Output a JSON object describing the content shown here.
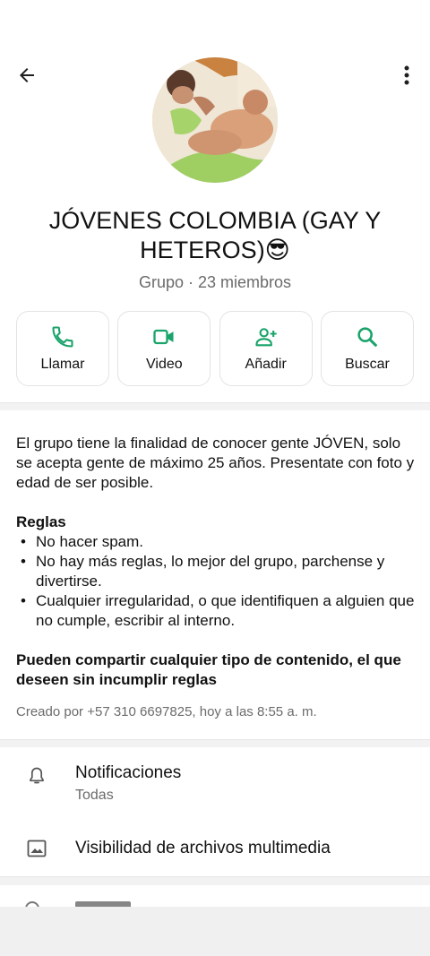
{
  "header": {
    "back_icon": "arrow-left-icon",
    "menu_icon": "more-vertical-icon"
  },
  "group": {
    "name": "JÓVENES COLOMBIA (GAY Y HETEROS)😎",
    "subtitle": "Grupo · 23 miembros"
  },
  "actions": [
    {
      "label": "Llamar",
      "icon": "phone-icon"
    },
    {
      "label": "Video",
      "icon": "video-icon"
    },
    {
      "label": "Añadir",
      "icon": "add-person-icon"
    },
    {
      "label": "Buscar",
      "icon": "search-icon"
    }
  ],
  "description": {
    "intro": "El grupo tiene la finalidad de conocer gente JÓVEN, solo se acepta gente de máximo 25 años. Presentate con foto y edad de ser posible.",
    "rules_title": "Reglas",
    "rules": [
      "No hacer spam.",
      "No hay más reglas, lo mejor del grupo, parchense y divertirse.",
      "Cualquier irregularidad, o que identifiquen a alguien que no cumple, escribir al interno."
    ],
    "bold_note": "Pueden compartir cualquier tipo de contenido, el que deseen sin incumplir reglas",
    "created": "Creado por +57 310 6697825, hoy a las 8:55 a. m."
  },
  "settings": {
    "notifications": {
      "title": "Notificaciones",
      "value": "Todas",
      "icon": "bell-icon"
    },
    "media_visibility": {
      "title": "Visibilidad de archivos multimedia",
      "icon": "image-icon"
    }
  },
  "colors": {
    "accent": "#1aa36a",
    "muted_text": "#6b6b6b"
  }
}
